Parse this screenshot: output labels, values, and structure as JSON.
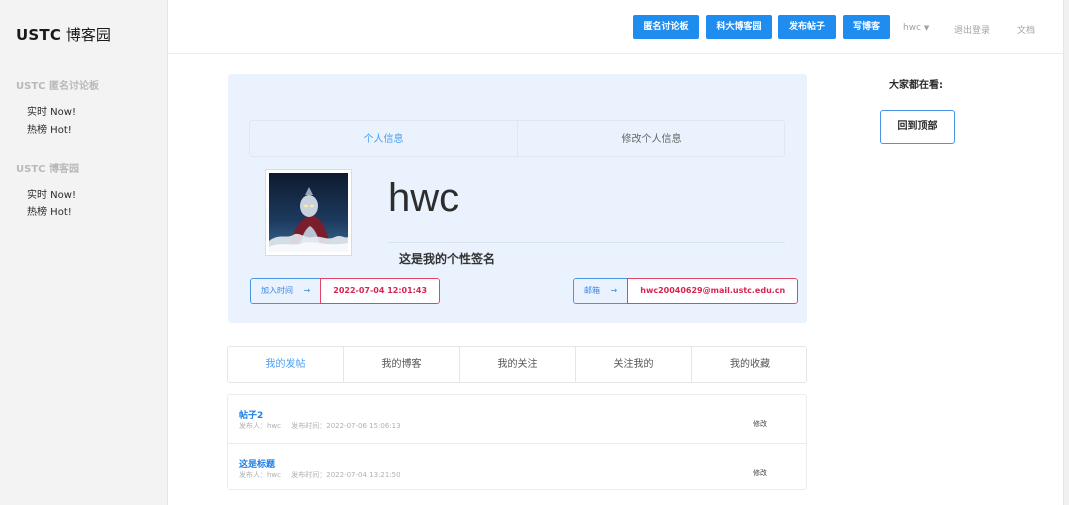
{
  "sidebar": {
    "brand_bold": "USTC",
    "brand_rest": "博客园",
    "sections": [
      {
        "title": "USTC 匿名讨论板",
        "items": [
          "实时 Now!",
          "热榜 Hot!"
        ]
      },
      {
        "title": "USTC 博客园",
        "items": [
          "实时 Now!",
          "热榜 Hot!"
        ]
      }
    ]
  },
  "topbar": {
    "buttons": [
      "匿名讨论板",
      "科大博客园",
      "发布帖子",
      "写博客"
    ],
    "user": "hwc",
    "logout": "退出登录",
    "docs": "文档",
    "dropdown_icon": "caret-down-icon",
    "accent_color": "#1f8cf0"
  },
  "profile": {
    "tabs": [
      "个人信息",
      "修改个人信息"
    ],
    "active_tab": 0,
    "username": "hwc",
    "signature": "这是我的个性签名",
    "join_label": "加入时间",
    "join_value": "2022-07-04 12:01:43",
    "email_label": "邮箱",
    "email_value": "hwc20040629@mail.ustc.edu.cn",
    "arrow": "→"
  },
  "content_tabs": [
    "我的发帖",
    "我的博客",
    "我的关注",
    "关注我的",
    "我的收藏"
  ],
  "active_content_tab": 0,
  "posts": [
    {
      "title": "帖子2",
      "author_label": "发布人：hwc",
      "time_label": "发布时间：2022-07-06 15:06:13",
      "edit": "修改"
    },
    {
      "title": "这是标题",
      "author_label": "发布人：hwc",
      "time_label": "发布时间：2022-07-04 13:21:50",
      "edit": "修改"
    }
  ],
  "right_panel": {
    "title": "大家都在看:",
    "back_to_top": "回到顶部"
  }
}
